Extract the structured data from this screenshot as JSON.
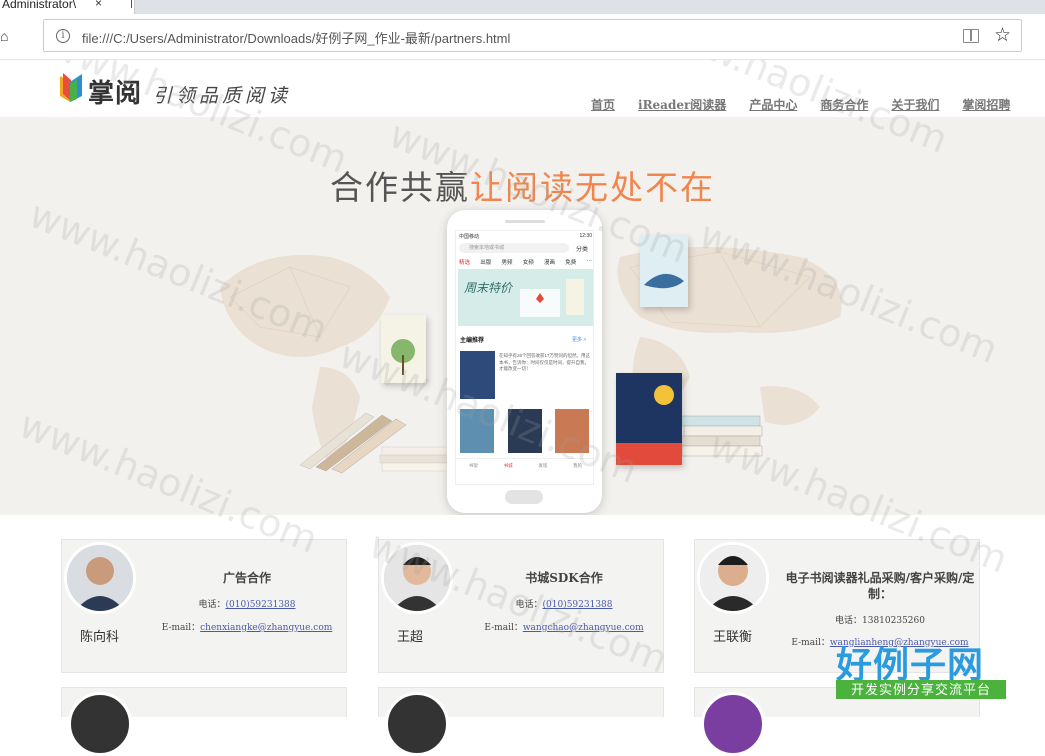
{
  "browser": {
    "tab_title": "Administrator\\",
    "tab_close": "×",
    "url": "file:///C:/Users/Administrator/Downloads/好例子网_作业-最新/partners.html",
    "info_glyph": "i",
    "star_glyph": "☆"
  },
  "header": {
    "logo_text": "掌阅",
    "slogan": "引领品质阅读",
    "nav": [
      "首页",
      "iReader阅读器",
      "产品中心",
      "商务合作",
      "关于我们",
      "掌阅招聘"
    ]
  },
  "banner": {
    "title_plain": "合作共赢",
    "title_highlight": "让阅读无处不在"
  },
  "phone_screen": {
    "carrier": "中国移动",
    "time": "12:30",
    "search_placeholder": "搜索本地或书城",
    "category": "分类",
    "tabs": [
      "精选",
      "出版",
      "男频",
      "女频",
      "漫画",
      "免费",
      "···"
    ],
    "feature_title": "周末特价",
    "section_title": "主编推荐",
    "section_more": "更多 >",
    "book_desc": "在知乎有26个回答收获17万赞同的坦然。用这本书，告诉你：时间仅仅是时间，提升自我，才能改变一切！",
    "bottom_tabs": [
      "书架",
      "书城",
      "发现",
      "我的"
    ]
  },
  "cards": [
    {
      "name": "陈向科",
      "title": "广告合作",
      "phone_label": "电话：",
      "phone": "(010)59231388",
      "email_label": "E-mail：",
      "email": "chenxiangke@zhangyue.com"
    },
    {
      "name": "王超",
      "title": "书城SDK合作",
      "phone_label": "电话：",
      "phone": "(010)59231388",
      "email_label": "E-mail：",
      "email": "wangchao@zhangyue.com"
    },
    {
      "name": "王联衡",
      "title": "电子书阅读器礼品采购/客户采购/定制：",
      "phone_label": "电话：",
      "phone": "13810235260",
      "email_label": "E-mail：",
      "email": "wanglianheng@zhangyue.com"
    }
  ],
  "watermark": "www.haolizi.com",
  "badge": {
    "big": "好例子网",
    "small": "开发实例分享交流平台"
  },
  "colors": {
    "accent": "#f0864e",
    "link": "#4a5aa8",
    "badge_blue": "#2b9be0",
    "badge_green": "#4bb33d"
  }
}
